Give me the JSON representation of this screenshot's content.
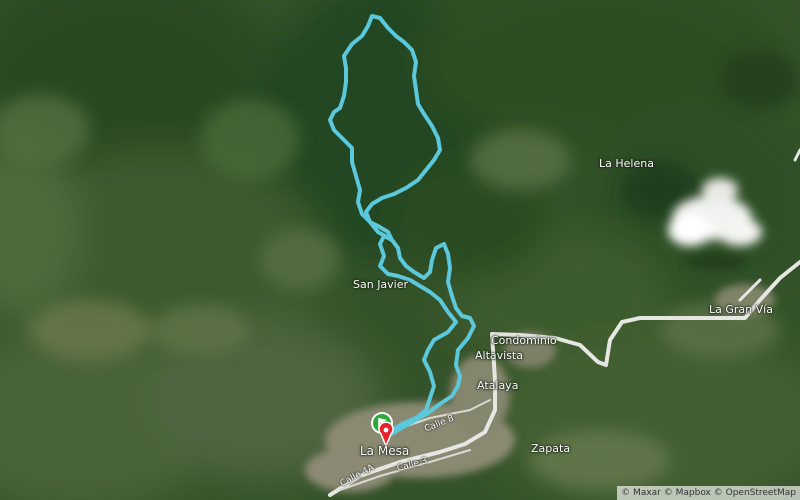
{
  "map": {
    "style": "satellite",
    "route_color": "#5cc8dc",
    "start_marker_color": "#2eaa3a",
    "end_marker_color": "#e8222a"
  },
  "places": {
    "la_helena": "La Helena",
    "san_javier": "San Javier",
    "condominio_line1": "Condominio",
    "condominio_line2": "Altavista",
    "atalaya": "Atalaya",
    "la_gran_via": "La Gran Vía",
    "zapata": "Zapata",
    "la_mesa": "La Mesa"
  },
  "roads": {
    "calle_8": "Calle 8",
    "calle_4a": "Calle 4A",
    "calle_3": "Calle 3"
  },
  "attribution": {
    "maxar": "© Maxar",
    "mapbox": "© Mapbox",
    "osm": "© OpenStreetMap"
  },
  "icons": {
    "start": "start-flag-icon",
    "end": "end-pin-icon"
  }
}
